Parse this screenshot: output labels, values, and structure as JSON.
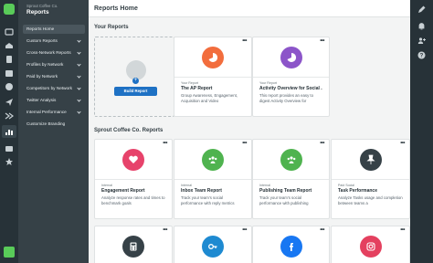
{
  "colors": {
    "brand_green": "#59cb59",
    "rail": "#273238",
    "subnav": "#364147",
    "primary_button": "#1e71c4"
  },
  "subnav": {
    "org_name": "Sprout Coffee Co.",
    "section_title": "Reports",
    "items": [
      {
        "label": "Reports Home"
      },
      {
        "label": "Custom Reports"
      },
      {
        "label": "Cross-Network Reports"
      },
      {
        "label": "Profiles by Network"
      },
      {
        "label": "Paid by Network"
      },
      {
        "label": "Competitors by Network"
      },
      {
        "label": "Twitter Analysis"
      },
      {
        "label": "Internal Performance"
      },
      {
        "label": "Customize Branding"
      }
    ]
  },
  "header": {
    "title": "Reports Home"
  },
  "your_reports": {
    "heading": "Your Reports",
    "build_button": "Build Report",
    "cards": [
      {
        "kind": "Your Report",
        "name": "The AP Report",
        "desc": "Group Awareness, Engagement, Acquisition and Video",
        "icon": "pie-chart-icon",
        "color": "#f26d3d"
      },
      {
        "kind": "Your Report",
        "name": "Activity Overview for Social ...",
        "desc": "This report provides an easy to digest Activity Overview for",
        "icon": "pie-chart-icon",
        "color": "#8c55c9"
      }
    ]
  },
  "company_reports": {
    "heading": "Sprout Coffee Co. Reports",
    "cards": [
      {
        "kind": "Internal",
        "name": "Engagement Report",
        "desc": "Analyze response rates and times to benchmark goals",
        "icon": "heart-icon",
        "color": "#e7436b"
      },
      {
        "kind": "Internal",
        "name": "Inbox Team Report",
        "desc": "Track your team's social performance with reply metrics",
        "icon": "team-icon",
        "color": "#4fb34f"
      },
      {
        "kind": "Internal",
        "name": "Publishing Team Report",
        "desc": "Track your team's social performance with publishing",
        "icon": "team-icon",
        "color": "#4fb34f"
      },
      {
        "kind": "Paid Social",
        "name": "Task Performance",
        "desc": "Analyze Tasks usage and completion between teams a",
        "icon": "pin-icon",
        "color": "#364147"
      }
    ],
    "row2_icons": [
      {
        "icon": "calculator-icon",
        "color": "#364147"
      },
      {
        "icon": "key-icon",
        "color": "#1e8ad1"
      },
      {
        "icon": "facebook-icon",
        "color": "#1877f2"
      },
      {
        "icon": "instagram-icon",
        "color": "#e4405f"
      }
    ]
  }
}
